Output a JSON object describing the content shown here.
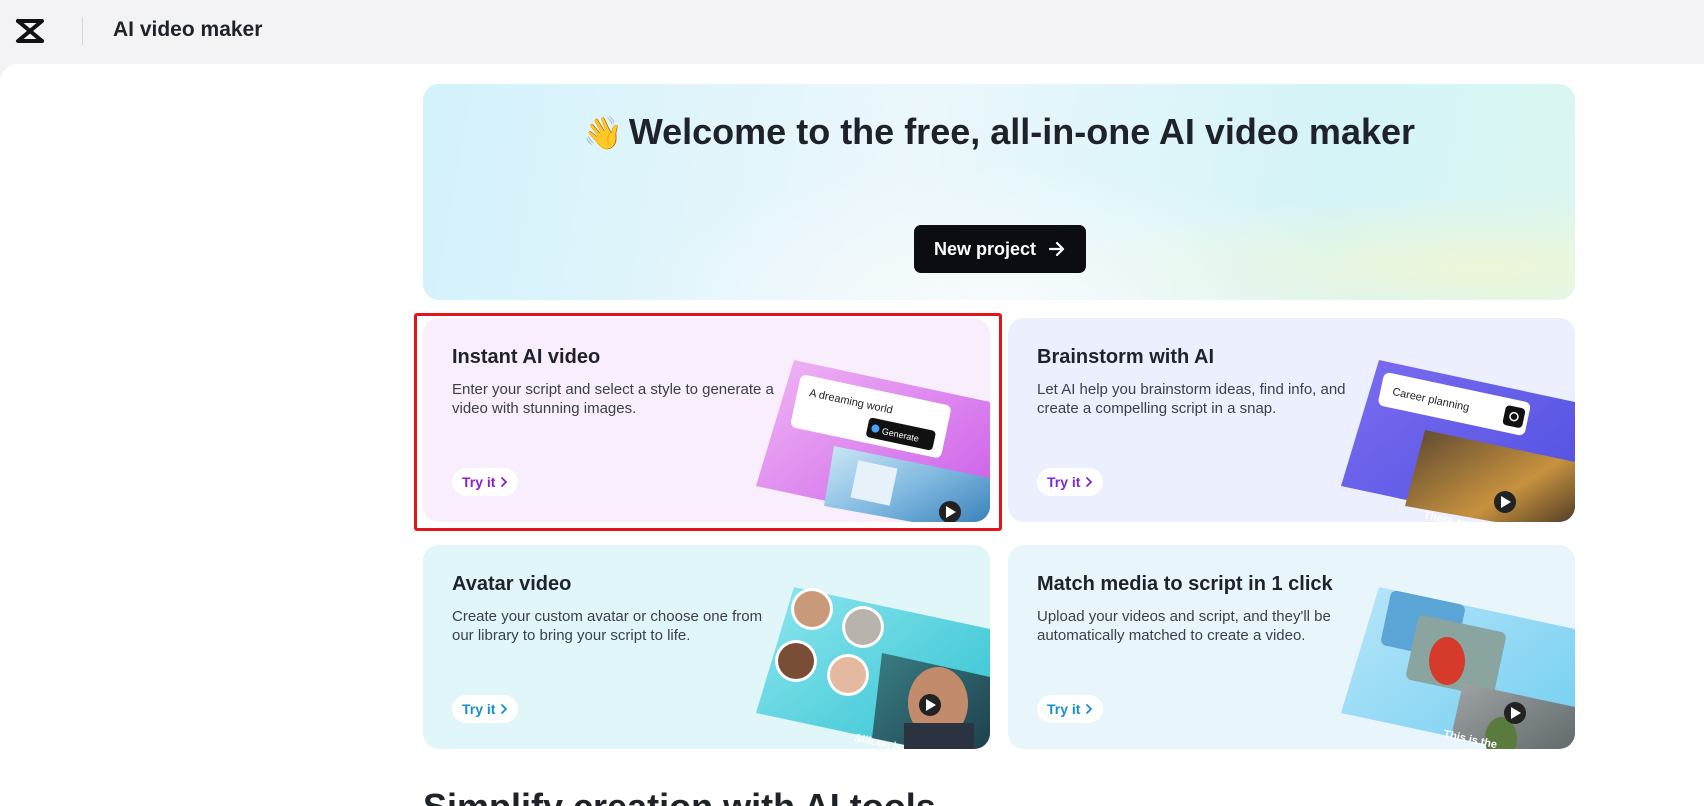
{
  "app": {
    "title": "AI video maker",
    "logo": "capcut-logo-icon"
  },
  "hero": {
    "emoji": "👋",
    "title": "Welcome to the free, all-in-one AI video maker",
    "new_project_label": "New project",
    "arrow_icon": "arrow-right-icon"
  },
  "cards": [
    {
      "title": "Instant AI video",
      "description": "Enter your script and select a style to generate a video with stunning images.",
      "try_label": "Try it",
      "art": {
        "prompt_text": "A dreaming world",
        "button_text": "Generate"
      }
    },
    {
      "title": "Brainstorm with AI",
      "description": "Let AI help you brainstorm ideas, find info, and create a compelling script in a snap.",
      "try_label": "Try it",
      "art": {
        "prompt_text": "Career planning",
        "caption": "There are"
      }
    },
    {
      "title": "Avatar video",
      "description": "Create your custom avatar or choose one from our library to bring your script to life.",
      "try_label": "Try it",
      "art": {
        "caption": "Silicon is"
      }
    },
    {
      "title": "Match media to script in 1 click",
      "description": "Upload your videos and script, and they'll be automatically matched to create a video.",
      "try_label": "Try it",
      "art": {
        "caption": "This is the"
      }
    }
  ],
  "highlight": {
    "target": "Instant AI video",
    "color": "#e3141b"
  },
  "bottom_heading": "Simplify creation with AI tools",
  "colors": {
    "background": "#f3f3f5",
    "button_dark": "#0b0d12",
    "purple": "#8b1fd6",
    "blue": "#178fcf"
  }
}
